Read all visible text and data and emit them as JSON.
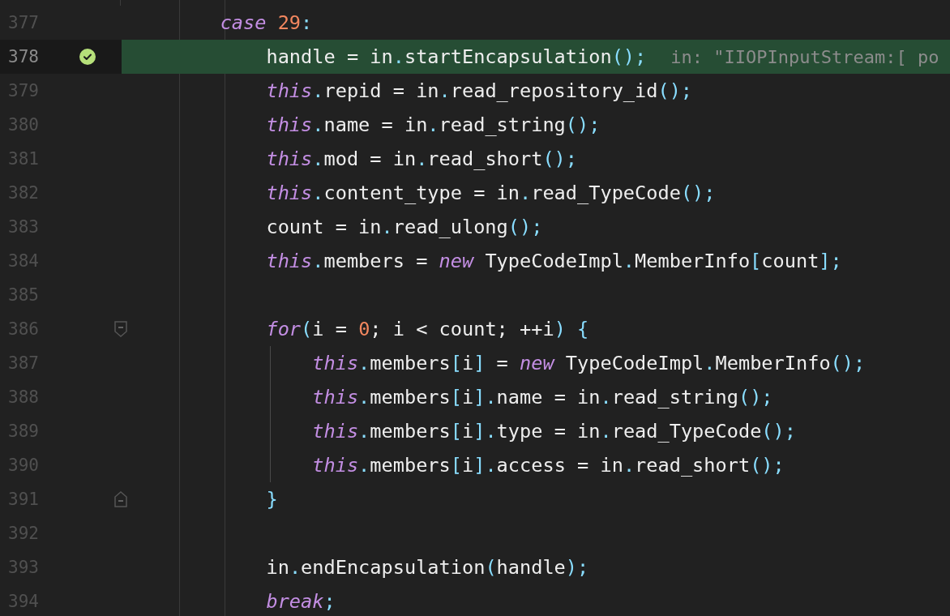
{
  "editor": {
    "lines": [
      {
        "number": "377",
        "current": false,
        "breakpoint": false,
        "tokens": [
          {
            "kind": "kw",
            "text": "case"
          },
          {
            "kind": "num",
            "text": " 29"
          },
          {
            "kind": "punc",
            "text": ":"
          }
        ],
        "children": [
          {
            "number": "378",
            "current": true,
            "breakpoint": true,
            "tokens": [
              {
                "kind": "plain",
                "text": "handle = in"
              },
              {
                "kind": "punc",
                "text": "."
              },
              {
                "kind": "plain",
                "text": "startEncapsulation"
              },
              {
                "kind": "punc",
                "text": "();"
              }
            ],
            "hint": "in: \"IIOPInputStream:[ po"
          },
          {
            "number": "379",
            "current": false,
            "breakpoint": false,
            "tokens": [
              {
                "kind": "kw",
                "text": "this"
              },
              {
                "kind": "punc",
                "text": "."
              },
              {
                "kind": "plain",
                "text": "repid = in"
              },
              {
                "kind": "punc",
                "text": "."
              },
              {
                "kind": "plain",
                "text": "read_repository_id"
              },
              {
                "kind": "punc",
                "text": "();"
              }
            ]
          },
          {
            "number": "380",
            "current": false,
            "breakpoint": false,
            "tokens": [
              {
                "kind": "kw",
                "text": "this"
              },
              {
                "kind": "punc",
                "text": "."
              },
              {
                "kind": "plain",
                "text": "name = in"
              },
              {
                "kind": "punc",
                "text": "."
              },
              {
                "kind": "plain",
                "text": "read_string"
              },
              {
                "kind": "punc",
                "text": "();"
              }
            ]
          },
          {
            "number": "381",
            "current": false,
            "breakpoint": false,
            "tokens": [
              {
                "kind": "kw",
                "text": "this"
              },
              {
                "kind": "punc",
                "text": "."
              },
              {
                "kind": "plain",
                "text": "mod = in"
              },
              {
                "kind": "punc",
                "text": "."
              },
              {
                "kind": "plain",
                "text": "read_short"
              },
              {
                "kind": "punc",
                "text": "();"
              }
            ]
          },
          {
            "number": "382",
            "current": false,
            "breakpoint": false,
            "tokens": [
              {
                "kind": "kw",
                "text": "this"
              },
              {
                "kind": "punc",
                "text": "."
              },
              {
                "kind": "plain",
                "text": "content_type = in"
              },
              {
                "kind": "punc",
                "text": "."
              },
              {
                "kind": "plain",
                "text": "read_TypeCode"
              },
              {
                "kind": "punc",
                "text": "();"
              }
            ]
          },
          {
            "number": "383",
            "current": false,
            "breakpoint": false,
            "tokens": [
              {
                "kind": "plain",
                "text": "count = in"
              },
              {
                "kind": "punc",
                "text": "."
              },
              {
                "kind": "plain",
                "text": "read_ulong"
              },
              {
                "kind": "punc",
                "text": "();"
              }
            ]
          },
          {
            "number": "384",
            "current": false,
            "breakpoint": false,
            "tokens": [
              {
                "kind": "kw",
                "text": "this"
              },
              {
                "kind": "punc",
                "text": "."
              },
              {
                "kind": "plain",
                "text": "members = "
              },
              {
                "kind": "kw",
                "text": "new"
              },
              {
                "kind": "plain",
                "text": " TypeCodeImpl"
              },
              {
                "kind": "punc",
                "text": "."
              },
              {
                "kind": "plain",
                "text": "MemberInfo"
              },
              {
                "kind": "punc",
                "text": "["
              },
              {
                "kind": "plain",
                "text": "count"
              },
              {
                "kind": "punc",
                "text": "];"
              }
            ]
          },
          {
            "number": "385",
            "current": false,
            "breakpoint": false
          },
          {
            "number": "386",
            "current": false,
            "breakpoint": false,
            "tokens": [
              {
                "kind": "kw",
                "text": "for"
              },
              {
                "kind": "punc",
                "text": "("
              },
              {
                "kind": "plain",
                "text": "i = "
              },
              {
                "kind": "num",
                "text": "0"
              },
              {
                "kind": "plain",
                "text": "; i < count; ++i"
              },
              {
                "kind": "punc",
                "text": ") {"
              }
            ],
            "children": [
              {
                "number": "387",
                "current": false,
                "breakpoint": false,
                "tokens": [
                  {
                    "kind": "kw",
                    "text": "this"
                  },
                  {
                    "kind": "punc",
                    "text": "."
                  },
                  {
                    "kind": "plain",
                    "text": "members"
                  },
                  {
                    "kind": "punc",
                    "text": "["
                  },
                  {
                    "kind": "plain",
                    "text": "i"
                  },
                  {
                    "kind": "punc",
                    "text": "]"
                  },
                  {
                    "kind": "plain",
                    "text": " = "
                  },
                  {
                    "kind": "kw",
                    "text": "new"
                  },
                  {
                    "kind": "plain",
                    "text": " TypeCodeImpl"
                  },
                  {
                    "kind": "punc",
                    "text": "."
                  },
                  {
                    "kind": "plain",
                    "text": "MemberInfo"
                  },
                  {
                    "kind": "punc",
                    "text": "();"
                  }
                ]
              },
              {
                "number": "388",
                "current": false,
                "breakpoint": false,
                "tokens": [
                  {
                    "kind": "kw",
                    "text": "this"
                  },
                  {
                    "kind": "punc",
                    "text": "."
                  },
                  {
                    "kind": "plain",
                    "text": "members"
                  },
                  {
                    "kind": "punc",
                    "text": "["
                  },
                  {
                    "kind": "plain",
                    "text": "i"
                  },
                  {
                    "kind": "punc",
                    "text": "]."
                  },
                  {
                    "kind": "plain",
                    "text": "name = in"
                  },
                  {
                    "kind": "punc",
                    "text": "."
                  },
                  {
                    "kind": "plain",
                    "text": "read_string"
                  },
                  {
                    "kind": "punc",
                    "text": "();"
                  }
                ]
              },
              {
                "number": "389",
                "current": false,
                "breakpoint": false,
                "tokens": [
                  {
                    "kind": "kw",
                    "text": "this"
                  },
                  {
                    "kind": "punc",
                    "text": "."
                  },
                  {
                    "kind": "plain",
                    "text": "members"
                  },
                  {
                    "kind": "punc",
                    "text": "["
                  },
                  {
                    "kind": "plain",
                    "text": "i"
                  },
                  {
                    "kind": "punc",
                    "text": "]."
                  },
                  {
                    "kind": "plain",
                    "text": "type = in"
                  },
                  {
                    "kind": "punc",
                    "text": "."
                  },
                  {
                    "kind": "plain",
                    "text": "read_TypeCode"
                  },
                  {
                    "kind": "punc",
                    "text": "();"
                  }
                ]
              },
              {
                "number": "390",
                "current": false,
                "breakpoint": false,
                "tokens": [
                  {
                    "kind": "kw",
                    "text": "this"
                  },
                  {
                    "kind": "punc",
                    "text": "."
                  },
                  {
                    "kind": "plain",
                    "text": "members"
                  },
                  {
                    "kind": "punc",
                    "text": "["
                  },
                  {
                    "kind": "plain",
                    "text": "i"
                  },
                  {
                    "kind": "punc",
                    "text": "]."
                  },
                  {
                    "kind": "plain",
                    "text": "access = in"
                  },
                  {
                    "kind": "punc",
                    "text": "."
                  },
                  {
                    "kind": "plain",
                    "text": "read_short"
                  },
                  {
                    "kind": "punc",
                    "text": "();"
                  }
                ]
              }
            ],
            "closing": {
              "number": "391",
              "current": false,
              "breakpoint": false,
              "tokens": [
                {
                  "kind": "punc",
                  "text": "}"
                }
              ]
            }
          },
          {
            "number": "392",
            "current": false,
            "breakpoint": false
          },
          {
            "number": "393",
            "current": false,
            "breakpoint": false,
            "tokens": [
              {
                "kind": "plain",
                "text": "in"
              },
              {
                "kind": "punc",
                "text": "."
              },
              {
                "kind": "plain",
                "text": "endEncapsulation"
              },
              {
                "kind": "punc",
                "text": "("
              },
              {
                "kind": "plain",
                "text": "handle"
              },
              {
                "kind": "punc",
                "text": ");"
              }
            ]
          },
          {
            "number": "394",
            "current": false,
            "breakpoint": false,
            "tokens": [
              {
                "kind": "kw",
                "text": "break"
              },
              {
                "kind": "punc",
                "text": ";"
              }
            ]
          }
        ]
      }
    ]
  }
}
